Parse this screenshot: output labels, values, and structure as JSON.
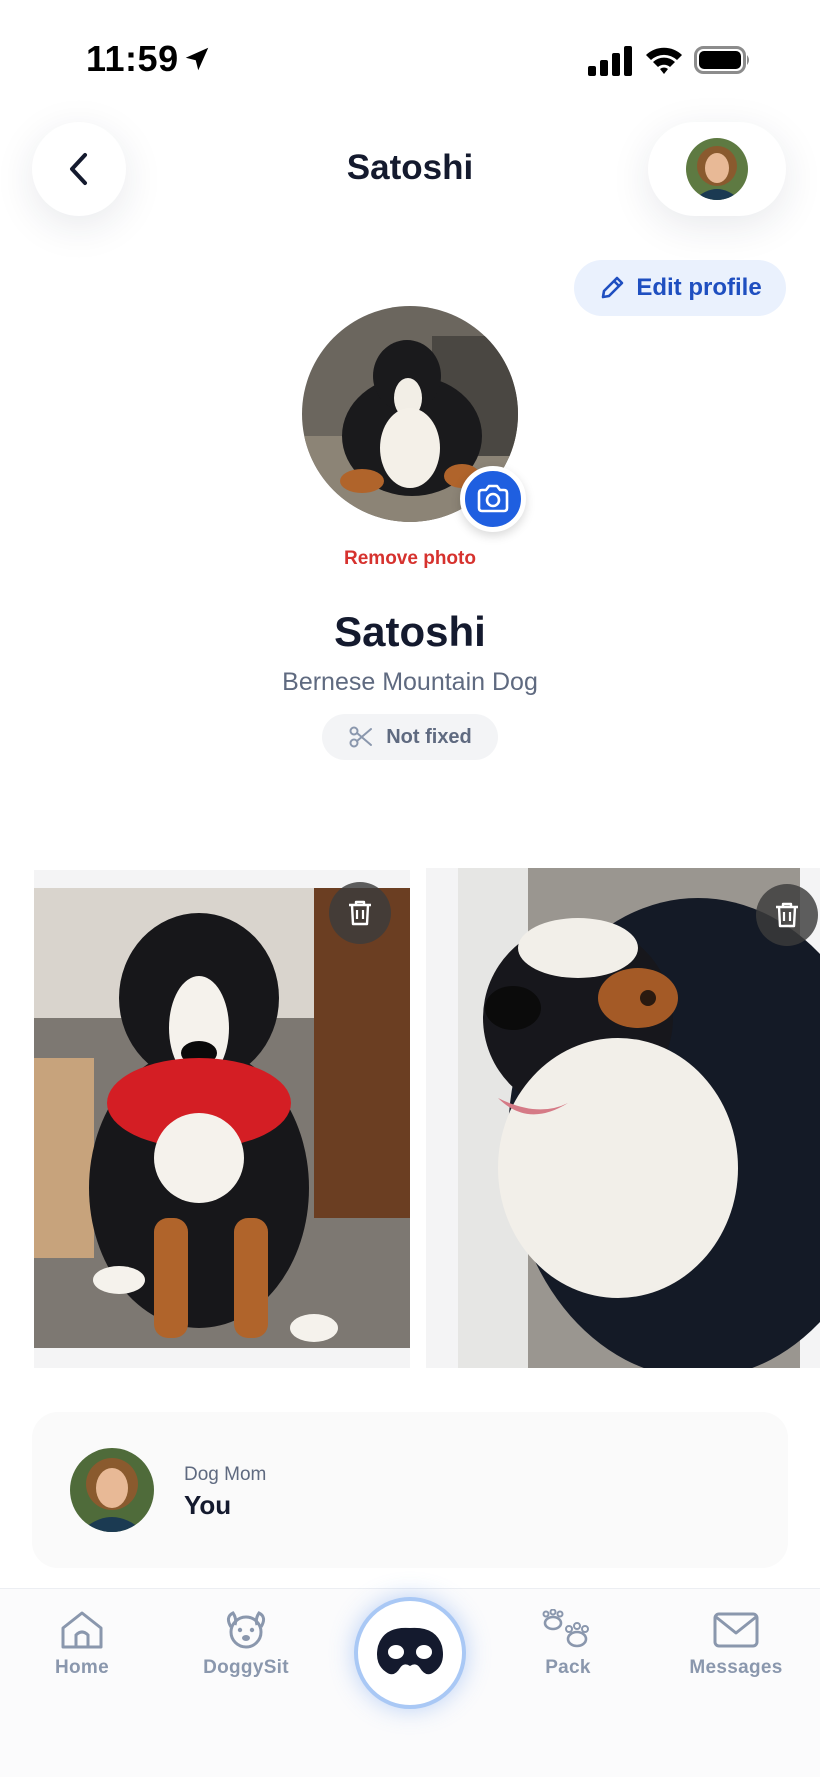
{
  "status_bar": {
    "time": "11:59"
  },
  "header": {
    "title": "Satoshi",
    "edit_label": "Edit profile"
  },
  "profile": {
    "remove_photo_label": "Remove photo",
    "name": "Satoshi",
    "breed": "Bernese Mountain Dog",
    "fixed_status": "Not fixed"
  },
  "owner": {
    "role": "Dog Mom",
    "name": "You"
  },
  "tabs": [
    {
      "label": "Home",
      "icon": "home-icon"
    },
    {
      "label": "DoggySit",
      "icon": "dog-face-icon"
    },
    {
      "label": "",
      "icon": "dog-nose-icon"
    },
    {
      "label": "Pack",
      "icon": "paws-icon"
    },
    {
      "label": "Messages",
      "icon": "envelope-icon"
    }
  ],
  "colors": {
    "accent": "#1f5fe0",
    "danger": "#d6322e",
    "title": "#141a2e",
    "muted": "#5f6a80",
    "tab_inactive": "#8a97ad"
  }
}
